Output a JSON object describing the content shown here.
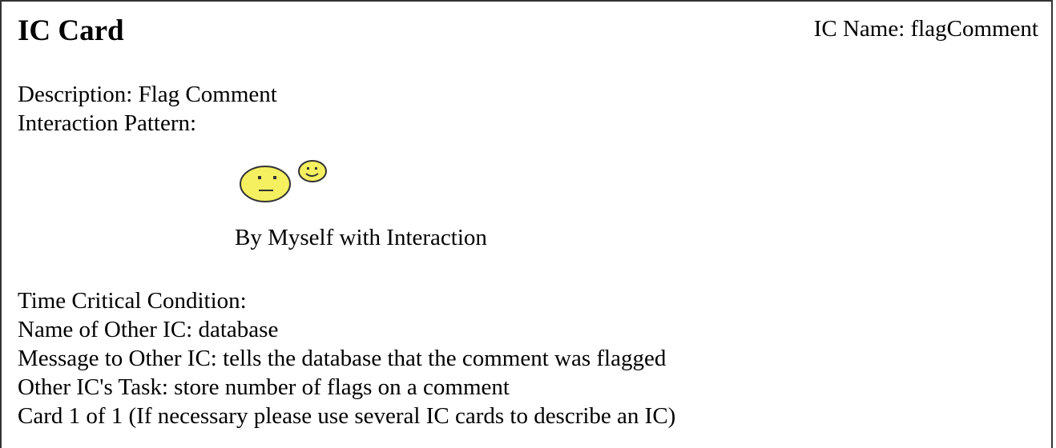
{
  "card": {
    "title": "IC Card",
    "ic_name": "IC Name: flagComment",
    "description": "Description: Flag Comment",
    "interaction_pattern_label": "Interaction Pattern:",
    "pattern": {
      "icon": "two-smiley-faces-icon",
      "label": "By Myself with Interaction",
      "face_color": "#f5f060",
      "outline_color": "#333333"
    },
    "time_critical": "Time Critical Condition:",
    "other_ic_name": "Name of Other IC: database",
    "message": "Message to Other IC: tells the database that the comment was flagged",
    "other_task": "Other IC's Task: store number of flags on a comment",
    "card_count": "Card 1 of 1 (If necessary please use several IC cards to describe an IC)"
  }
}
